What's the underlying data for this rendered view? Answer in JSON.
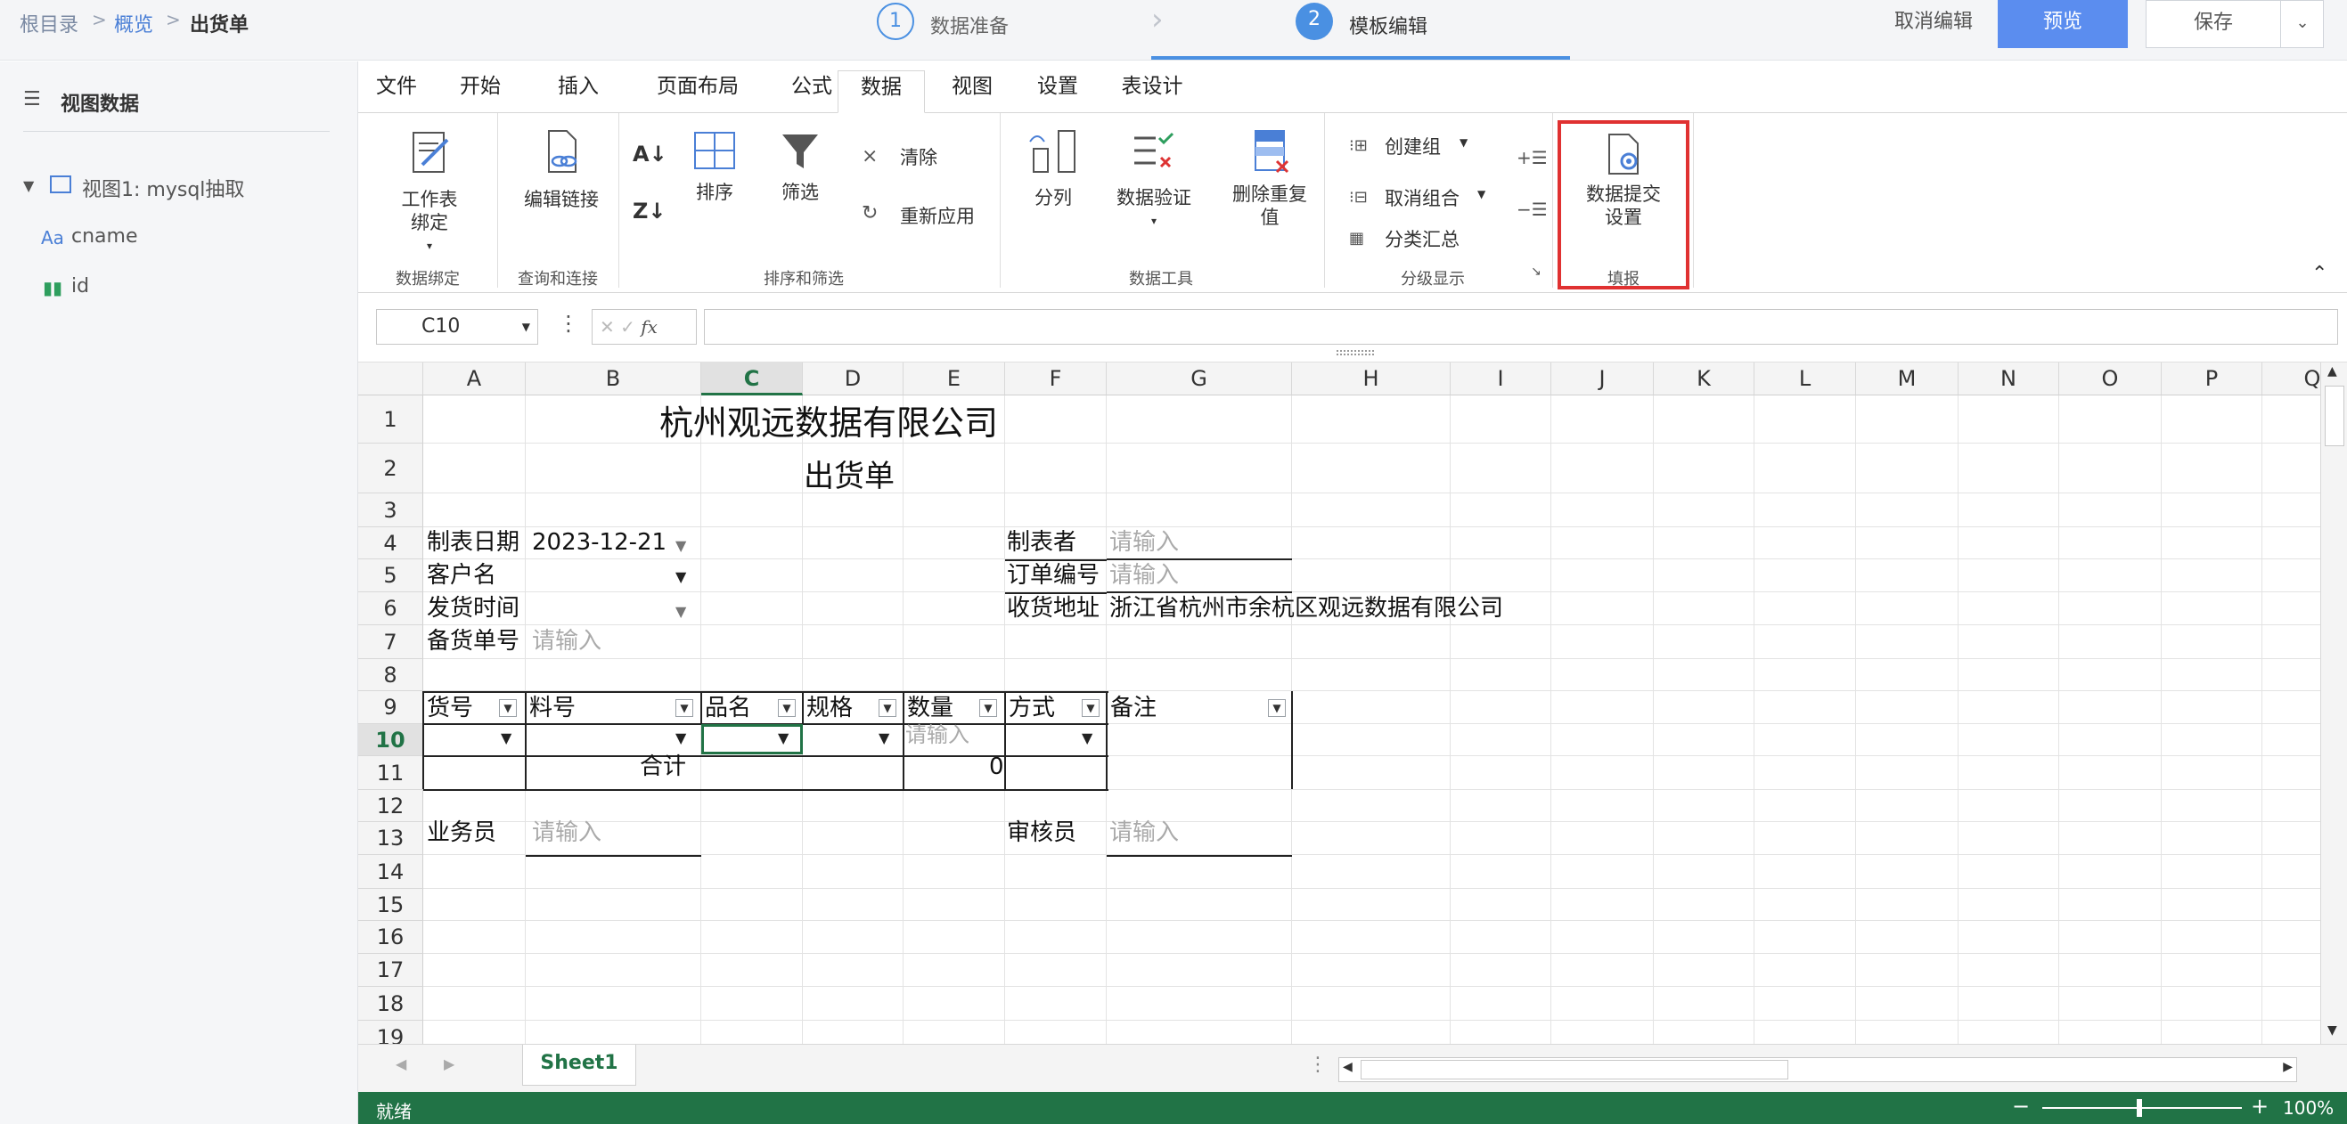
{
  "breadcrumb": {
    "root": "根目录",
    "overview": "概览",
    "current": "出货单",
    "sep": ">"
  },
  "steps": [
    {
      "num": "1",
      "label": "数据准备"
    },
    {
      "num": "2",
      "label": "模板编辑"
    }
  ],
  "actions": {
    "cancel_edit": "取消编辑",
    "preview": "预览",
    "save": "保存"
  },
  "left": {
    "title": "视图数据",
    "view_label": "视图1: mysql抽取",
    "fields": [
      {
        "type": "Aa",
        "name": "cname"
      },
      {
        "type": "chart",
        "name": "id"
      }
    ]
  },
  "tabs": [
    "文件",
    "开始",
    "插入",
    "页面布局",
    "公式",
    "数据",
    "视图",
    "设置",
    "表设计"
  ],
  "active_tab": "数据",
  "ribbon": {
    "worksheet_bind": "工作表绑定",
    "edit_link": "编辑链接",
    "sort": "排序",
    "filter": "筛选",
    "clear": "清除",
    "reapply": "重新应用",
    "split": "分列",
    "validate": "数据验证",
    "remove_dup": "删除重复值",
    "create_group": "创建组",
    "ungroup": "取消组合",
    "subtotal": "分类汇总",
    "submit_settings": "数据提交设置",
    "groups": {
      "bind": "数据绑定",
      "query": "查询和连接",
      "sortfilter": "排序和筛选",
      "tools": "数据工具",
      "outline": "分级显示",
      "fill": "填报"
    }
  },
  "formula": {
    "cell_ref": "C10",
    "fx": "fx",
    "value": ""
  },
  "columns": [
    "A",
    "B",
    "C",
    "D",
    "E",
    "F",
    "G",
    "H",
    "I",
    "J",
    "K",
    "L",
    "M",
    "N",
    "O",
    "P",
    "Q"
  ],
  "rows": [
    "1",
    "2",
    "3",
    "4",
    "5",
    "6",
    "7",
    "8",
    "9",
    "10",
    "11",
    "12",
    "13",
    "14",
    "15",
    "16",
    "17",
    "18",
    "19"
  ],
  "sheet": {
    "title": "杭州观远数据有限公司",
    "subtitle": "出货单",
    "date_label": "制表日期",
    "date_value": "2023-12-21",
    "creator_label": "制表者",
    "placeholder": "请输入",
    "customer_label": "客户名",
    "order_label": "订单编号",
    "ship_time_label": "发货时间",
    "address_label": "收货地址",
    "address_value": "浙江省杭州市余杭区观远数据有限公司",
    "stock_no_label": "备货单号",
    "headers": [
      "货号",
      "料号",
      "品名",
      "规格",
      "数量",
      "方式",
      "备注"
    ],
    "total_label": "合计",
    "total_value": "0",
    "sales_label": "业务员",
    "reviewer_label": "审核员"
  },
  "sheet_tab": "Sheet1",
  "status": {
    "ready": "就绪",
    "zoom": "100%"
  },
  "colors": {
    "accent": "#4a90e2",
    "excel_green": "#217346",
    "highlight": "#e03131"
  }
}
